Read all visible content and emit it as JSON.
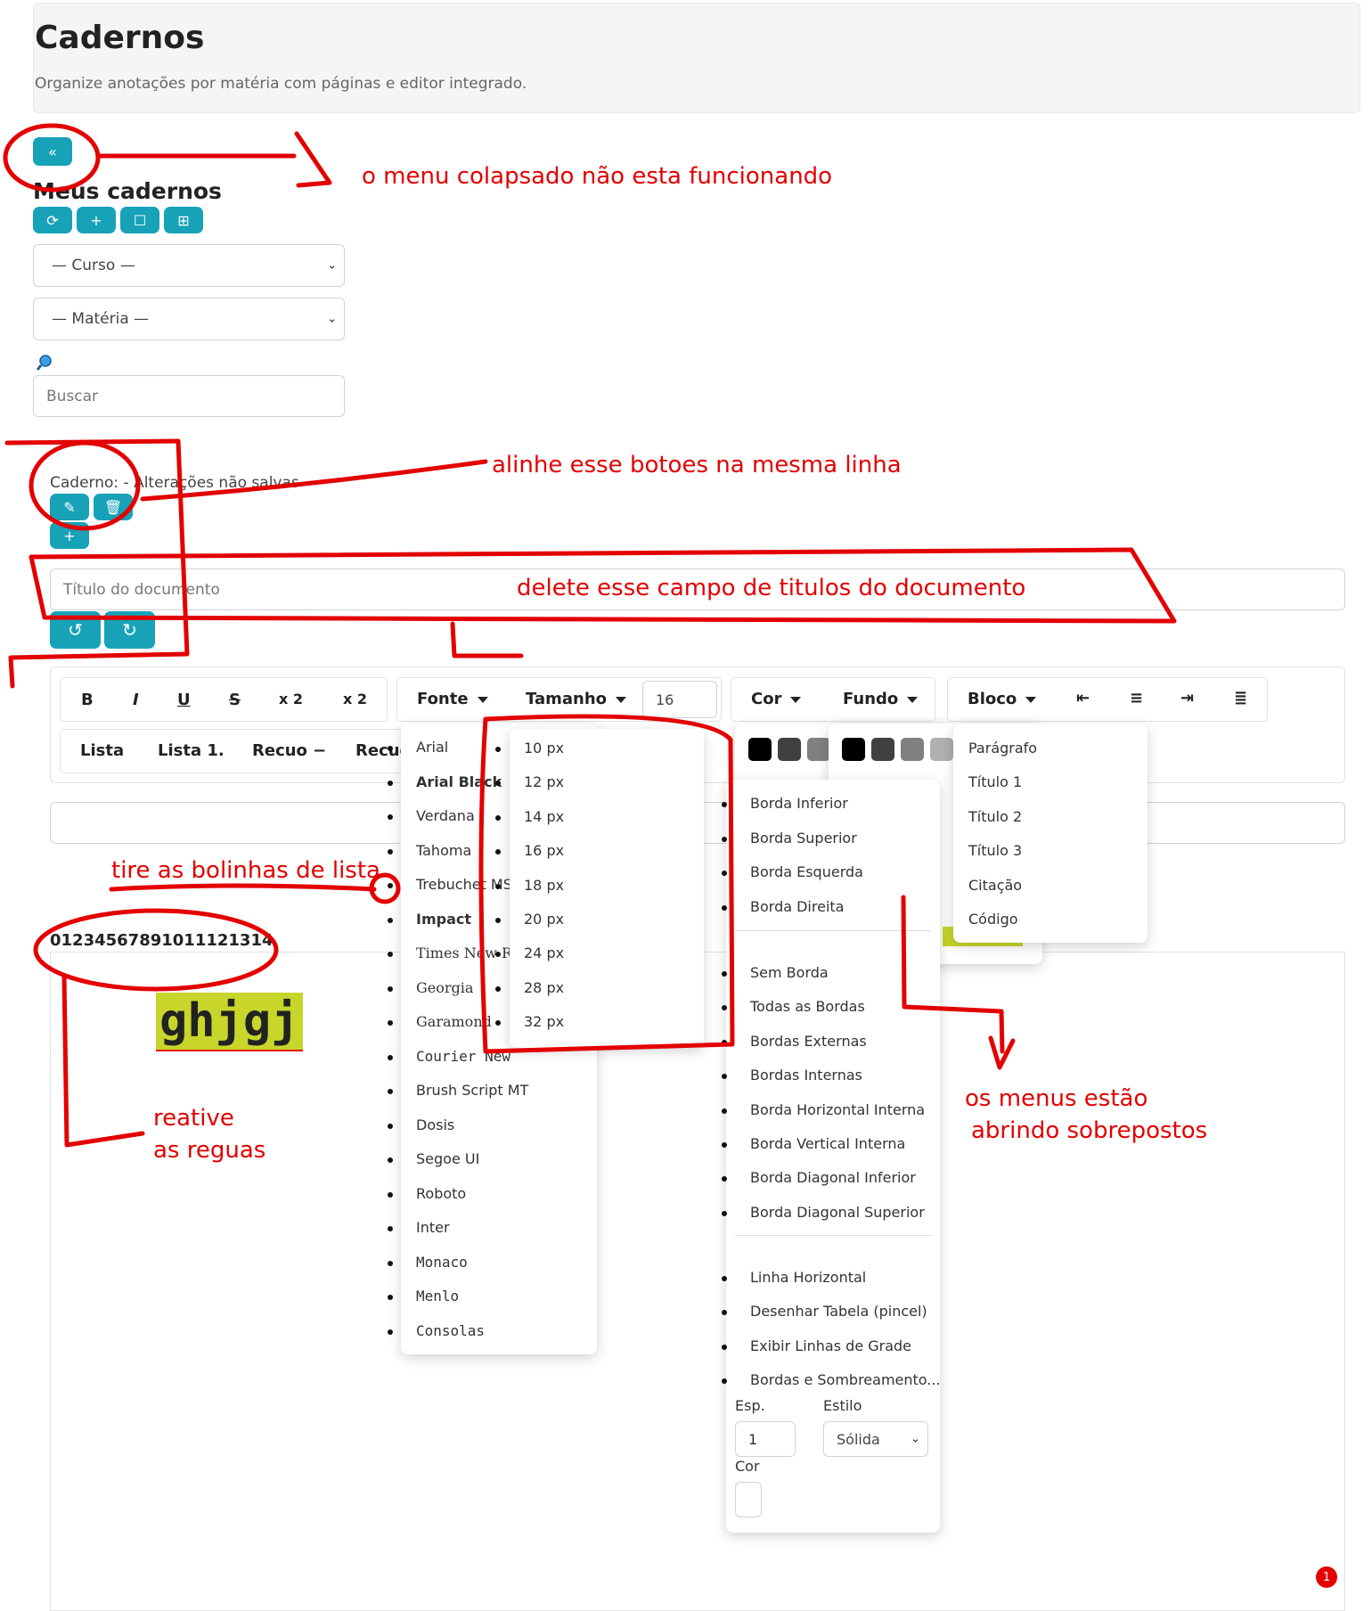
{
  "header": {
    "title": "Cadernos",
    "subtitle": "Organize anotações por matéria com páginas e editor integrado."
  },
  "sidebar": {
    "heading": "Meus cadernos",
    "course_select": "— Curso —",
    "subject_select": "— Matéria —",
    "search_placeholder": "Buscar"
  },
  "doc": {
    "status": "Caderno: - Alterações não salvas",
    "title_placeholder": "Título do documento"
  },
  "toolbar": {
    "bold": "B",
    "italic": "I",
    "underline": "U",
    "strike": "S",
    "subscript": "x 2",
    "superscript": "x 2",
    "font": "Fonte",
    "size": "Tamanho",
    "size_value": "16",
    "color": "Cor",
    "background": "Fundo",
    "block": "Bloco",
    "list": "Lista",
    "ordered_list": "Lista 1.",
    "outdent": "Recuo −",
    "indent": "Recuo"
  },
  "font_menu": [
    "Arial",
    "Arial Black",
    "Verdana",
    "Tahoma",
    "Trebuchet MS",
    "Impact",
    "Times New Roman",
    "Georgia",
    "Garamond",
    "Courier New",
    "Brush Script MT",
    "Dosis",
    "Segoe UI",
    "Roboto",
    "Inter",
    "Monaco",
    "Menlo",
    "Consolas"
  ],
  "size_menu": [
    "10 px",
    "12 px",
    "14 px",
    "16 px",
    "18 px",
    "20 px",
    "24 px",
    "28 px",
    "32 px"
  ],
  "block_menu": [
    "Parágrafo",
    "Título 1",
    "Título 2",
    "Título 3",
    "Citação",
    "Código"
  ],
  "border_menu": {
    "group1": [
      "Borda Inferior",
      "Borda Superior",
      "Borda Esquerda",
      "Borda Direita"
    ],
    "group2": [
      "Sem Borda",
      "Todas as Bordas",
      "Bordas Externas",
      "Bordas Internas",
      "Borda Horizontal Interna",
      "Borda Vertical Interna",
      "Borda Diagonal Inferior",
      "Borda Diagonal Superior"
    ],
    "group3": [
      "Linha Horizontal",
      "Desenhar Tabela (pincel)",
      "Exibir Linhas de Grade",
      "Bordas e Sombreamento..."
    ],
    "width_label": "Esp.",
    "width_value": "1",
    "style_label": "Estilo",
    "style_value": "Sólida",
    "color_label": "Cor"
  },
  "editor": {
    "ruler_text": "01234567891011121314",
    "content": "ghjgj"
  },
  "notification_count": "1",
  "annotations": {
    "menu": "o menu colapsado não esta funcionando",
    "align": "alinhe esse botoes na mesma linha",
    "delete": "delete esse campo de titulos do documento",
    "bullets": "tire as bolinhas de lista",
    "rulers_1": "reative",
    "rulers_2": "as reguas",
    "menus_1": "os menus estão",
    "menus_2": "abrindo sobrepostos"
  },
  "colors": {
    "teal": "#17a2b8",
    "annotation": "#e30000",
    "highlight": "#c8d62b"
  }
}
